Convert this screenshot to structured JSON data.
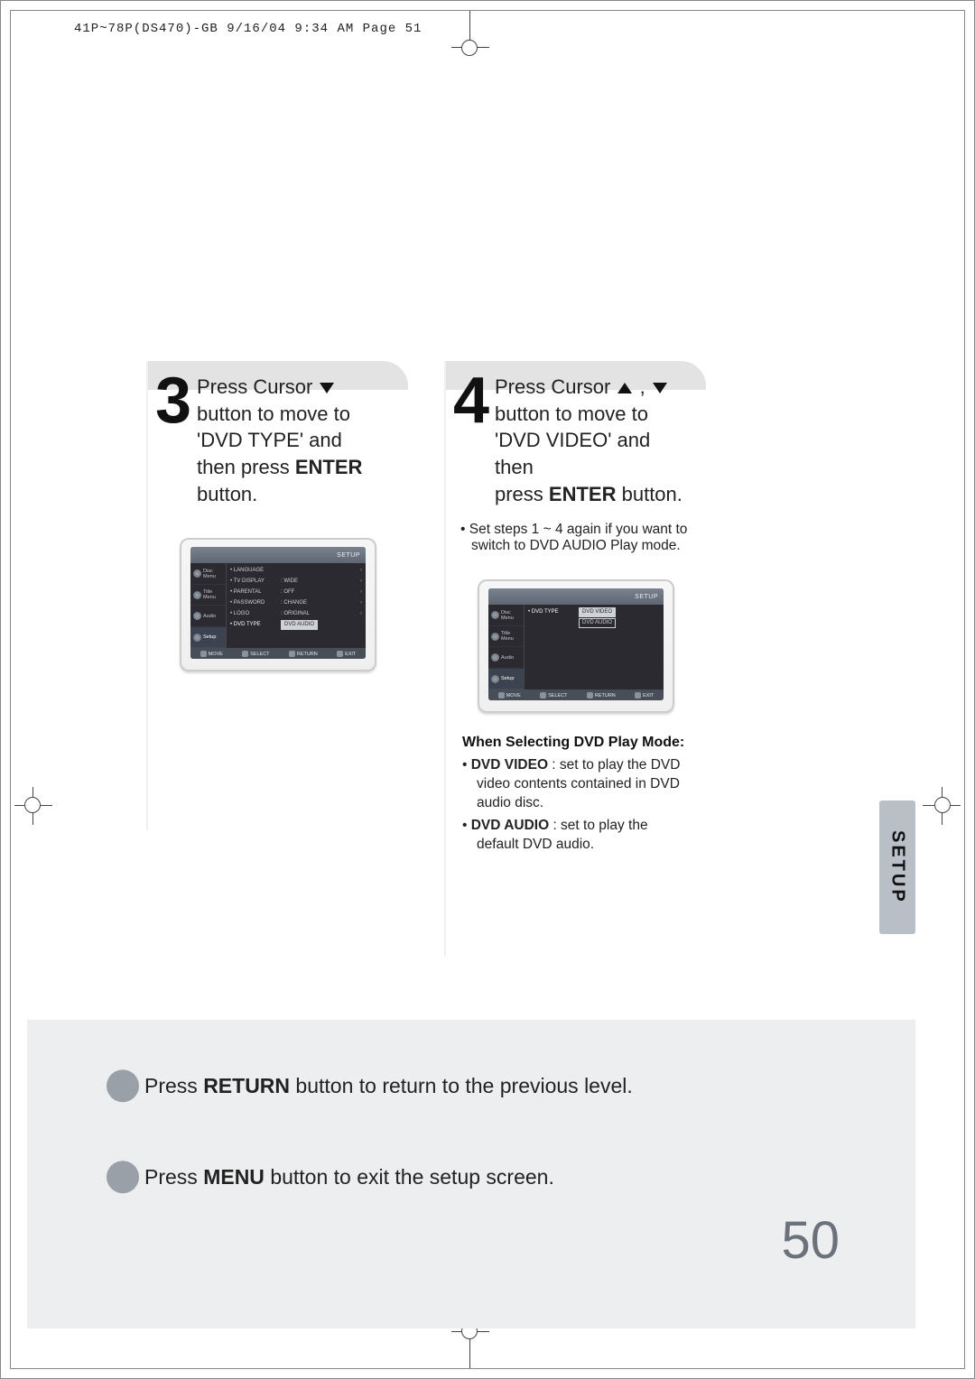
{
  "runhead": "41P~78P(DS470)-GB  9/16/04 9:34 AM  Page 51",
  "step3": {
    "num": "3",
    "text_parts": {
      "a": "Press Cursor ",
      "b": "button to move to",
      "c": "'DVD TYPE' and",
      "d": "then press ",
      "enter": "ENTER",
      "e": "button."
    }
  },
  "step4": {
    "num": "4",
    "text_parts": {
      "a": "Press Cursor ",
      "b": "button to move to",
      "c": "'DVD VIDEO' and then",
      "d": "press ",
      "enter": "ENTER",
      "e": " button."
    },
    "note": "Set steps 1 ~ 4 again if you want to switch to DVD AUDIO Play mode."
  },
  "play_mode": {
    "heading": "When Selecting DVD Play Mode:",
    "video_term": "DVD VIDEO",
    "video_def": " : set to play the DVD video contents contained in DVD audio disc.",
    "audio_term": "DVD AUDIO",
    "audio_def": " : set to play the default DVD audio."
  },
  "setup_tab": "SETUP",
  "bottom": {
    "line1_a": "Press ",
    "line1_b": "RETURN",
    "line1_c": " button to return to the previous level.",
    "line2_a": "Press ",
    "line2_b": "MENU",
    "line2_c": " button to exit the setup screen."
  },
  "page_number": "50",
  "tv_common": {
    "topbar_right": "SETUP",
    "side_items": [
      "Disc Menu",
      "Title Menu",
      "Audio",
      "Setup"
    ],
    "foot": [
      "MOVE",
      "SELECT",
      "RETURN",
      "EXIT"
    ]
  },
  "tv3_rows": [
    {
      "k": "LANGUAGE",
      "v": "",
      "ar": "›"
    },
    {
      "k": "TV DISPLAY",
      "v": ": WIDE",
      "ar": "›"
    },
    {
      "k": "PARENTAL",
      "v": ": OFF",
      "ar": "›"
    },
    {
      "k": "PASSWORD",
      "v": ": CHANGE",
      "ar": "›"
    },
    {
      "k": "LOGO",
      "v": ": ORIGINAL",
      "ar": "›"
    },
    {
      "k": "DVD TYPE",
      "v": "DVD AUDIO",
      "hi": true
    }
  ],
  "tv4_rows": [
    {
      "k": "DVD TYPE",
      "v": "DVD VIDEO",
      "hi": true
    },
    {
      "k": "",
      "v": "DVD AUDIO",
      "hi": false
    }
  ]
}
